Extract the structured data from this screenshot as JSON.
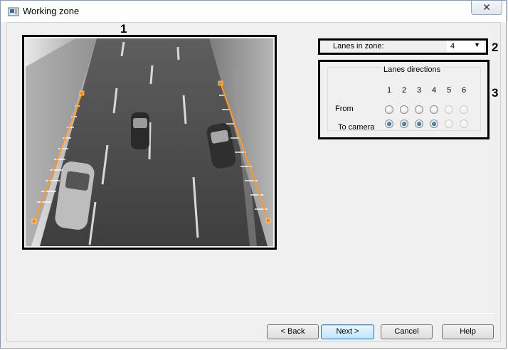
{
  "window": {
    "title": "Working zone",
    "close_symbol": "✕"
  },
  "callouts": [
    "1",
    "2",
    "3"
  ],
  "lanes": {
    "label": "Lanes in zone:",
    "value": "4"
  },
  "directions": {
    "title": "Lanes directions",
    "lane_numbers": [
      "1",
      "2",
      "3",
      "4",
      "5",
      "6"
    ],
    "rows": [
      {
        "label": "From",
        "checked": [
          false,
          false,
          false,
          false,
          false,
          false
        ]
      },
      {
        "label": "To camera",
        "checked": [
          true,
          true,
          true,
          true,
          false,
          false
        ]
      }
    ],
    "enabled_count": 4
  },
  "buttons": {
    "back": "< Back",
    "next": "Next >",
    "cancel": "Cancel",
    "help": "Help"
  },
  "colors": {
    "zone_line": "#ff9a1f",
    "zone_handle": "#ff8c00",
    "highlight_frame": "#000000"
  }
}
